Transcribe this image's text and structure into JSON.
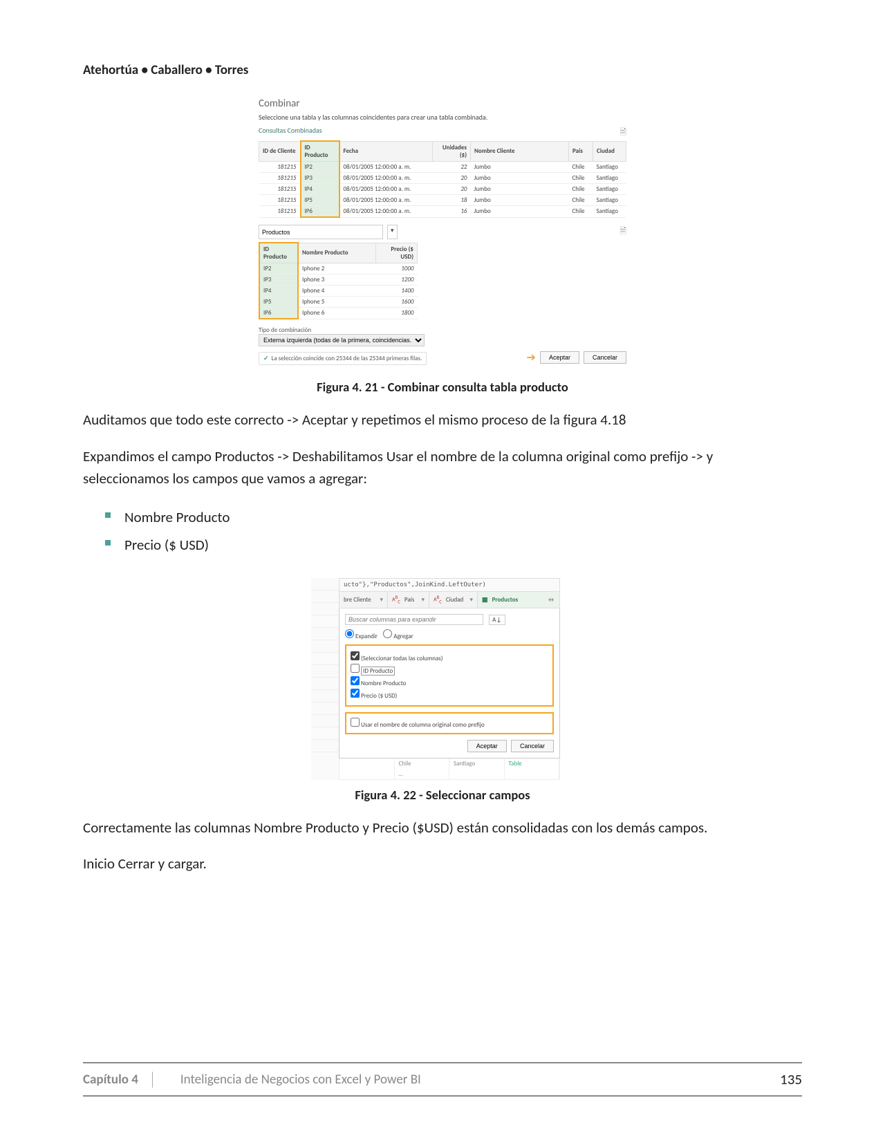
{
  "header": {
    "authors": "Atehortúa • Caballero • Torres"
  },
  "fig21": {
    "title": "Combinar",
    "subtitle": "Seleccione una tabla y las columnas coincidentes para crear una tabla combinada.",
    "section1": "Consultas Combinadas",
    "t1_headers": [
      "ID de Cliente",
      "ID Producto",
      "Fecha",
      "Unidades ($)",
      "Nombre Cliente",
      "País",
      "Ciudad"
    ],
    "t1_rows": [
      [
        "181215",
        "IP2",
        "08/01/2005 12:00:00 a. m.",
        "22",
        "Jumbo",
        "Chile",
        "Santiago"
      ],
      [
        "181215",
        "IP3",
        "08/01/2005 12:00:00 a. m.",
        "20",
        "Jumbo",
        "Chile",
        "Santiago"
      ],
      [
        "181215",
        "IP4",
        "08/01/2005 12:00:00 a. m.",
        "20",
        "Jumbo",
        "Chile",
        "Santiago"
      ],
      [
        "181215",
        "IP5",
        "08/01/2005 12:00:00 a. m.",
        "18",
        "Jumbo",
        "Chile",
        "Santiago"
      ],
      [
        "181215",
        "IP6",
        "08/01/2005 12:00:00 a. m.",
        "16",
        "Jumbo",
        "Chile",
        "Santiago"
      ]
    ],
    "dropdown": "Productos",
    "t2_headers": [
      "ID Producto",
      "Nombre Producto",
      "Precio ($ USD)"
    ],
    "t2_rows": [
      [
        "IP2",
        "Iphone 2",
        "1000"
      ],
      [
        "IP3",
        "Iphone 3",
        "1200"
      ],
      [
        "IP4",
        "Iphone 4",
        "1400"
      ],
      [
        "IP5",
        "Iphone 5",
        "1600"
      ],
      [
        "IP6",
        "Iphone 6",
        "1800"
      ]
    ],
    "tipo_label": "Tipo de combinación",
    "tipo_value": "Externa izquierda (todas de la primera, coincidencias...",
    "msg": "La selección coincide con 25344 de las 25344 primeras filas.",
    "btn_accept": "Aceptar",
    "btn_cancel": "Cancelar",
    "caption": "Figura 4. 21 -   Combinar consulta tabla producto"
  },
  "para1": "Auditamos que todo este correcto -> Aceptar y repetimos el mismo proceso de la figura 4.18",
  "para2": "Expandimos el campo Productos -> Deshabilitamos Usar el nombre de la columna original como prefijo -> y seleccionamos los campos que vamos a agregar:",
  "list": [
    "Nombre Producto",
    "Precio ($ USD)"
  ],
  "fig22": {
    "formula": "ucto\"},\"Productos\",JoinKind.LeftOuter)",
    "cols": {
      "c0": "bre Cliente",
      "c1": "País",
      "c2": "Ciudad",
      "c3": "Productos"
    },
    "search_ph": "Buscar columnas para expandir",
    "radio_expand": "Expandir",
    "radio_add": "Agregar",
    "chk_all": "(Seleccionar todas las columnas)",
    "chk_id": "ID Producto",
    "chk_nombre": "Nombre Producto",
    "chk_precio": "Precio ($ USD)",
    "prefix": "Usar el nombre de columna original como prefijo",
    "btn_accept": "Aceptar",
    "btn_cancel": "Cancelar",
    "shadow": {
      "a": "Chile",
      "b": "Santiago",
      "c": "Table"
    },
    "caption": "Figura 4. 22 -   Seleccionar campos"
  },
  "para3": "Correctamente las columnas Nombre Producto y Precio ($USD) están consolidadas con los demás campos.",
  "para4": "Inicio Cerrar y cargar.",
  "footer": {
    "chapter": "Capítulo 4",
    "title": "Inteligencia de Negocios con Excel y Power BI",
    "page": "135"
  }
}
